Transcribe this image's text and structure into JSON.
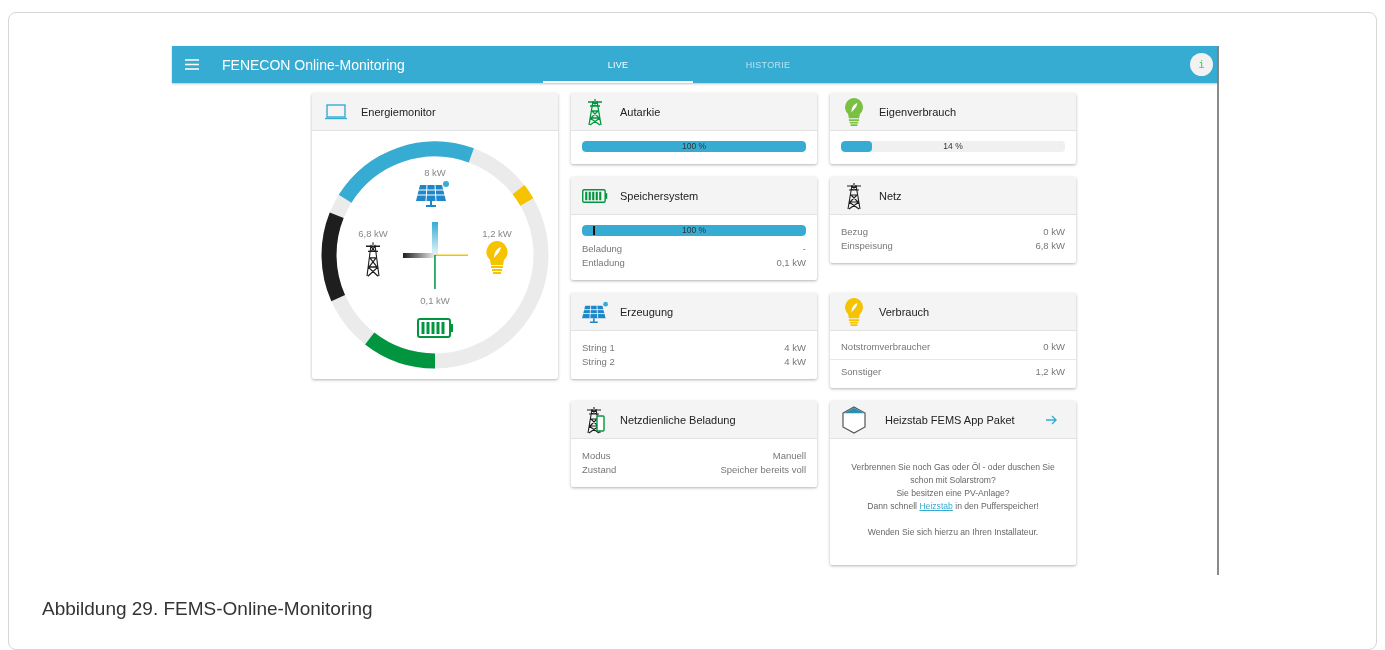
{
  "header": {
    "title": "FENECON Online-Monitoring",
    "tabs": [
      {
        "label": "LIVE",
        "selected": true
      },
      {
        "label": "HISTORIE",
        "selected": false
      }
    ],
    "info": "i"
  },
  "energy_monitor": {
    "title": "Energiemonitor",
    "production": "8 kW",
    "grid": "6,8 kW",
    "consumption": "1,2 kW",
    "storage": "0,1 kW"
  },
  "autarkie": {
    "title": "Autarkie",
    "level": 1,
    "reading": "100 %"
  },
  "eigenverbrauch": {
    "title": "Eigenverbrauch",
    "level": 0.14,
    "reading": "14 %"
  },
  "speichersystem": {
    "title": "Speichersystem",
    "level": 1,
    "reading": "100 %",
    "rows": [
      {
        "label": "Beladung",
        "value": "-"
      },
      {
        "label": "Entladung",
        "value": "0,1 kW"
      }
    ]
  },
  "netz": {
    "title": "Netz",
    "rows": [
      {
        "label": "Bezug",
        "value": "0 kW"
      },
      {
        "label": "Einspeisung",
        "value": "6,8 kW"
      }
    ]
  },
  "erzeugung": {
    "title": "Erzeugung",
    "rows": [
      {
        "label": "String 1",
        "value": "4 kW"
      },
      {
        "label": "String 2",
        "value": "4 kW"
      }
    ]
  },
  "verbrauch": {
    "title": "Verbrauch",
    "rows": [
      {
        "label": "Notstromverbraucher",
        "value": "0 kW"
      },
      {
        "label": "Sonstiger",
        "value": "1,2 kW"
      }
    ]
  },
  "netzdienliche_beladung": {
    "title": "Netzdienliche Beladung",
    "rows": [
      {
        "label": "Modus",
        "value": "Manuell"
      },
      {
        "label": "Zustand",
        "value": "Speicher bereits voll"
      }
    ]
  },
  "heizstab": {
    "title": "Heizstab FEMS App Paket",
    "text_1": "Verbrennen Sie noch Gas oder Öl - oder duschen Sie schon mit Solarstrom?",
    "text_2": "Sie besitzen eine PV-Anlage?",
    "text_3_before": "Dann schnell",
    "link": "Heizstab",
    "text_3_after": "in den Pufferspeicher!",
    "text_4": "Wenden Sie sich hierzu an Ihren Installateur."
  },
  "caption": "Abbildung 29. FEMS-Online-Monitoring"
}
